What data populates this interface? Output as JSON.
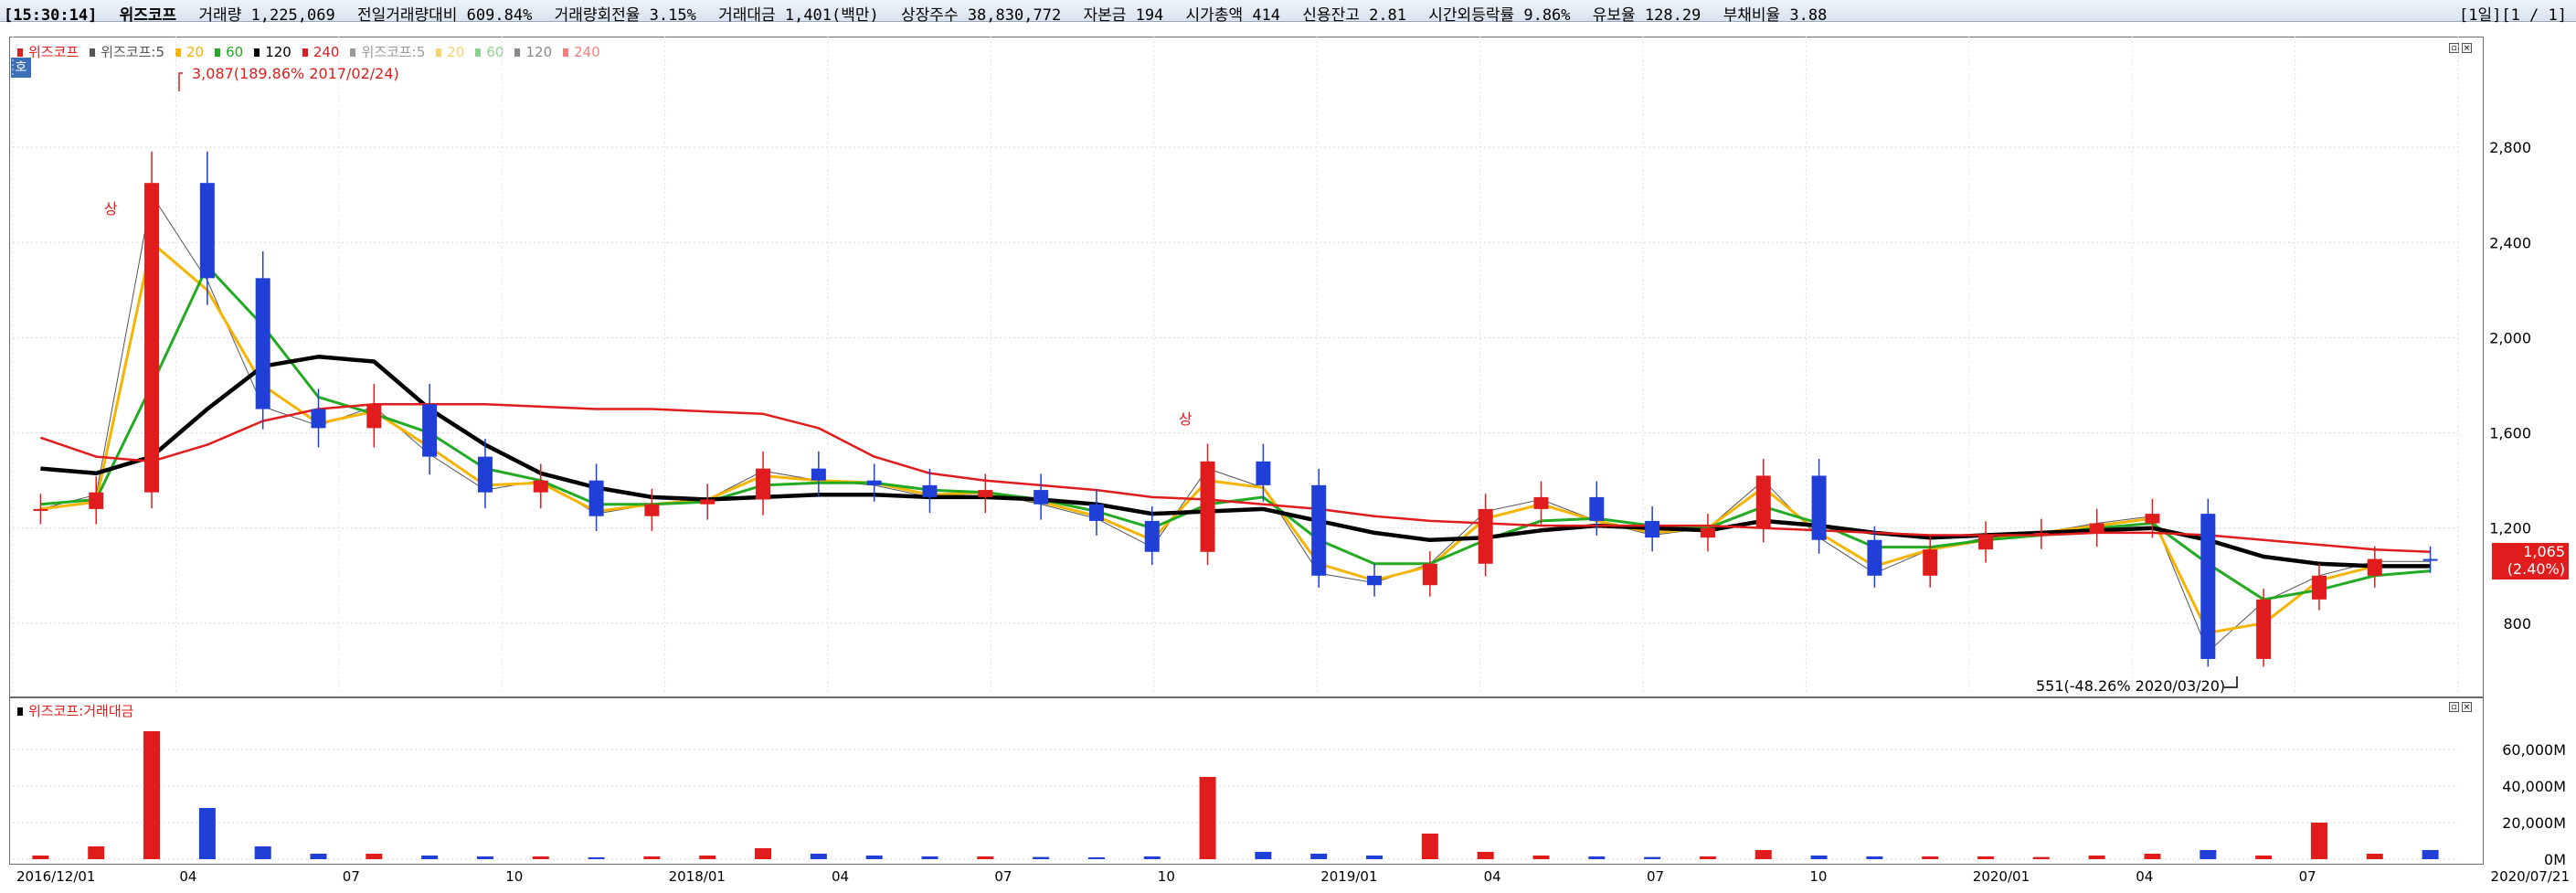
{
  "header": {
    "time": "[15:30:14]",
    "stats": [
      "위즈코프",
      "거래량 1,225,069",
      "전일거래량대비 609.84%",
      "거래량회전율 3.15%",
      "거래대금 1,401(백만)",
      "상장주수 38,830,772",
      "자본금 194",
      "시가총액 414",
      "신용잔고 2.81",
      "시간외등락률 9.86%",
      "유보율 128.29",
      "부채비율 3.88"
    ],
    "pager": "[1일][1 / 1]"
  },
  "legend": {
    "items": [
      {
        "label": "위즈코프",
        "color": "#e01c1c"
      },
      {
        "label": "위즈코프:5",
        "color": "#555555"
      },
      {
        "label": "20",
        "color": "#f4b400"
      },
      {
        "label": "60",
        "color": "#22aa22"
      },
      {
        "label": "120",
        "color": "#000000"
      },
      {
        "label": "240",
        "color": "#e01c1c"
      },
      {
        "label": "위즈코프:5",
        "color": "#999999"
      },
      {
        "label": "20",
        "color": "#f4d46a"
      },
      {
        "label": "60",
        "color": "#8fd08f"
      },
      {
        "label": "120",
        "color": "#888888"
      },
      {
        "label": "240",
        "color": "#f08080"
      }
    ],
    "volume": "위즈코프:거래대금",
    "badge": "호"
  },
  "annotations": {
    "high": "3,087(189.86% 2017/02/24)",
    "low": "551(-48.26% 2020/03/20)",
    "upper_limit_1": "상",
    "upper_limit_2": "상"
  },
  "price_tag": {
    "price": "1,065",
    "change": "(2.40%)"
  },
  "colors": {
    "up": "#e01c1c",
    "down": "#1f3fd6",
    "ma5": "#555555",
    "ma20": "#f4b400",
    "ma60": "#22aa22",
    "ma120": "#000000",
    "ma240": "#e01c1c"
  },
  "chart_data": {
    "type": "line",
    "x_ticks": [
      "2016/12/01",
      "04",
      "07",
      "10",
      "2018/01",
      "04",
      "07",
      "10",
      "2019/01",
      "04",
      "07",
      "10",
      "2020/01",
      "04",
      "07",
      "2020/07/21"
    ],
    "price_axis": {
      "ylim": [
        551,
        3087
      ],
      "ticks": [
        "2,800",
        "2,400",
        "2,000",
        "1,600",
        "1,200",
        "800"
      ]
    },
    "volume_axis": {
      "ylim": [
        0,
        75000
      ],
      "ticks": [
        "60,000M",
        "40,000M",
        "20,000M",
        "0M"
      ]
    },
    "x": [
      "2016/12",
      "2017/01",
      "2017/02",
      "2017/03",
      "2017/04",
      "2017/05",
      "2017/06",
      "2017/07",
      "2017/08",
      "2017/09",
      "2017/10",
      "2017/11",
      "2017/12",
      "2018/01",
      "2018/02",
      "2018/03",
      "2018/04",
      "2018/05",
      "2018/06",
      "2018/07",
      "2018/08",
      "2018/09",
      "2018/10",
      "2018/11",
      "2018/12",
      "2019/01",
      "2019/02",
      "2019/03",
      "2019/04",
      "2019/05",
      "2019/06",
      "2019/07",
      "2019/08",
      "2019/09",
      "2019/10",
      "2019/11",
      "2019/12",
      "2020/01",
      "2020/02",
      "2020/03",
      "2020/04",
      "2020/05",
      "2020/06",
      "2020/07"
    ],
    "series": [
      {
        "name": "위즈코프",
        "values": [
          1280,
          1350,
          2650,
          2250,
          1700,
          1620,
          1720,
          1500,
          1350,
          1400,
          1250,
          1300,
          1320,
          1450,
          1400,
          1380,
          1330,
          1360,
          1300,
          1230,
          1100,
          1480,
          1380,
          1000,
          960,
          1050,
          1280,
          1330,
          1230,
          1160,
          1200,
          1420,
          1150,
          1000,
          1110,
          1170,
          1180,
          1220,
          1260,
          650,
          900,
          1000,
          1070,
          1065
        ]
      },
      {
        "name": "5",
        "values": [
          1280,
          1340,
          2600,
          2240,
          1710,
          1630,
          1710,
          1510,
          1360,
          1400,
          1260,
          1300,
          1320,
          1440,
          1400,
          1380,
          1330,
          1350,
          1300,
          1240,
          1120,
          1450,
          1370,
          1010,
          970,
          1050,
          1270,
          1320,
          1230,
          1170,
          1200,
          1400,
          1160,
          1010,
          1110,
          1160,
          1180,
          1220,
          1250,
          680,
          890,
          1000,
          1060,
          1060
        ]
      },
      {
        "name": "20",
        "values": [
          1280,
          1310,
          2400,
          2200,
          1800,
          1640,
          1690,
          1540,
          1380,
          1390,
          1270,
          1300,
          1320,
          1420,
          1400,
          1390,
          1340,
          1350,
          1310,
          1250,
          1150,
          1400,
          1370,
          1050,
          980,
          1040,
          1240,
          1300,
          1230,
          1180,
          1200,
          1370,
          1180,
          1040,
          1110,
          1150,
          1180,
          1210,
          1240,
          760,
          800,
          980,
          1040,
          1040
        ]
      },
      {
        "name": "60",
        "values": [
          1300,
          1320,
          1800,
          2300,
          2050,
          1750,
          1680,
          1600,
          1450,
          1400,
          1300,
          1300,
          1310,
          1380,
          1390,
          1390,
          1360,
          1350,
          1320,
          1270,
          1200,
          1300,
          1330,
          1150,
          1050,
          1050,
          1150,
          1230,
          1240,
          1210,
          1200,
          1290,
          1220,
          1120,
          1120,
          1150,
          1170,
          1200,
          1220,
          1050,
          900,
          940,
          1000,
          1020
        ]
      },
      {
        "name": "120",
        "values": [
          1450,
          1430,
          1500,
          1700,
          1880,
          1920,
          1900,
          1700,
          1550,
          1430,
          1370,
          1330,
          1320,
          1330,
          1340,
          1340,
          1330,
          1330,
          1320,
          1300,
          1260,
          1270,
          1280,
          1230,
          1180,
          1150,
          1160,
          1190,
          1210,
          1200,
          1190,
          1230,
          1210,
          1180,
          1160,
          1170,
          1180,
          1190,
          1200,
          1150,
          1080,
          1050,
          1040,
          1040
        ]
      },
      {
        "name": "240",
        "values": [
          1580,
          1500,
          1480,
          1550,
          1650,
          1700,
          1720,
          1720,
          1720,
          1710,
          1700,
          1700,
          1690,
          1680,
          1620,
          1500,
          1430,
          1400,
          1380,
          1360,
          1330,
          1320,
          1300,
          1280,
          1250,
          1230,
          1220,
          1210,
          1210,
          1210,
          1210,
          1200,
          1190,
          1180,
          1170,
          1170,
          1170,
          1180,
          1180,
          1170,
          1150,
          1130,
          1110,
          1100
        ]
      },
      {
        "name": "거래대금",
        "values": [
          2000,
          7000,
          70000,
          28000,
          7000,
          3000,
          3000,
          2000,
          1500,
          1500,
          1000,
          1500,
          2000,
          6000,
          3000,
          2000,
          1500,
          1500,
          1200,
          1000,
          1500,
          45000,
          4000,
          3000,
          2000,
          14000,
          4000,
          2000,
          1500,
          1200,
          1500,
          5000,
          2000,
          1500,
          1500,
          1500,
          1200,
          2000,
          3000,
          5000,
          2000,
          20000,
          3000,
          5000
        ]
      }
    ]
  }
}
